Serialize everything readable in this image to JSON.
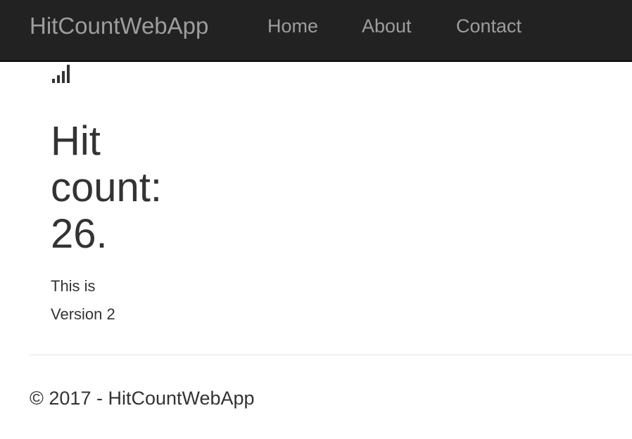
{
  "navbar": {
    "brand": "HitCountWebApp",
    "links": [
      {
        "label": "Home"
      },
      {
        "label": "About"
      },
      {
        "label": "Contact"
      }
    ]
  },
  "main": {
    "icon": "signal-bars-icon",
    "heading": "Hit count: 26.",
    "subtext": "This is Version 2"
  },
  "footer": {
    "text": "© 2017 - HitCountWebApp"
  },
  "colors": {
    "navbar_background": "#222222",
    "navbar_text": "#9d9d9d",
    "body_text": "#333333"
  }
}
